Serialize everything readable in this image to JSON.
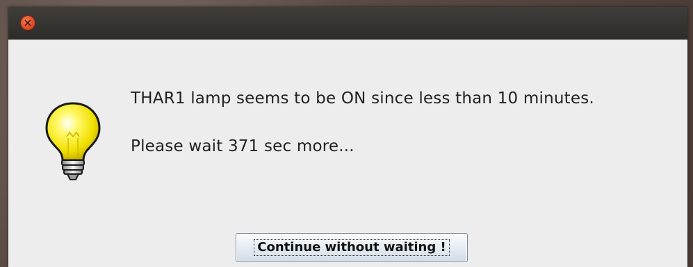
{
  "window": {
    "close_icon": "close-icon"
  },
  "dialog": {
    "icon": "lightbulb-icon",
    "message_line1": "THAR1 lamp seems to be ON since less than 10 minutes.",
    "message_line2": "Please wait 371 sec more..."
  },
  "buttons": {
    "continue_label": "Continue without waiting !"
  },
  "colors": {
    "close_button": "#e0502a",
    "bulb": "#f5e600",
    "titlebar": "#3a3935",
    "dialog_bg": "#ededed"
  }
}
